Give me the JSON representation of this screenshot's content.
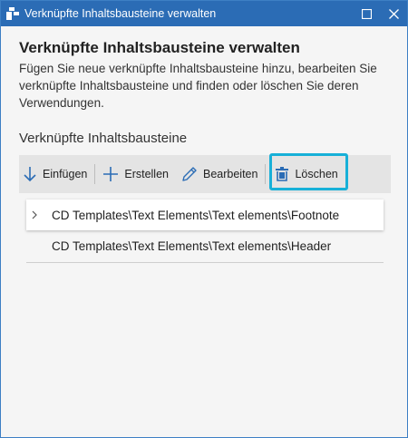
{
  "window": {
    "title": "Verknüpfte Inhaltsbausteine verwalten"
  },
  "main": {
    "heading": "Verknüpfte Inhaltsbausteine verwalten",
    "description": "Fügen Sie neue verknüpfte Inhaltsbausteine hinzu, bearbeiten Sie verknüpfte Inhaltsbausteine und finden oder löschen Sie deren Verwendungen.",
    "section_label": "Verknüpfte Inhaltsbausteine"
  },
  "toolbar": {
    "insert_label": "Einfügen",
    "create_label": "Erstellen",
    "edit_label": "Bearbeiten",
    "delete_label": "Löschen"
  },
  "list": {
    "items": [
      {
        "label": "CD Templates\\Text Elements\\Text elements\\Footnote",
        "expanded": false,
        "selected": true
      },
      {
        "label": "CD Templates\\Text Elements\\Text elements\\Header",
        "expanded": false,
        "selected": false
      }
    ]
  },
  "colors": {
    "titlebar": "#2b6cb5",
    "highlight": "#17b0d8",
    "accent_icon": "#2b6cb5"
  }
}
